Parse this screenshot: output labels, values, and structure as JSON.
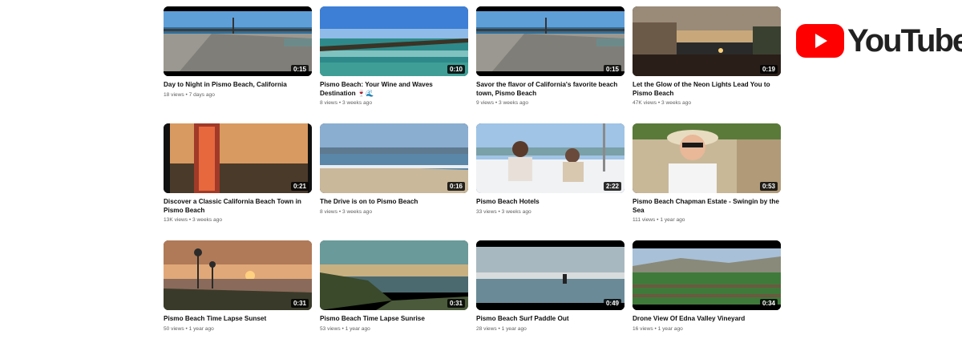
{
  "brand": {
    "name": "YouTube",
    "accent": "#ff0000"
  },
  "videos": [
    {
      "title": "Day to Night in Pismo Beach, California",
      "meta": "18 views • 7 days ago",
      "duration": "0:15",
      "thumb": "pier-pan"
    },
    {
      "title": "Pismo Beach: Your Wine and Waves Destination 🍷🌊",
      "meta": "8 views • 3 weeks ago",
      "duration": "0:10",
      "thumb": "pier-ocean"
    },
    {
      "title": "Savor the flavor of California's favorite beach town, Pismo Beach",
      "meta": "9 views • 3 weeks ago",
      "duration": "0:15",
      "thumb": "pier-pan"
    },
    {
      "title": "Let the Glow of the Neon Lights Lead You to Pismo Beach",
      "meta": "47K views • 3 weeks ago",
      "duration": "0:19",
      "thumb": "dusk-street"
    },
    {
      "title": "Discover a Classic California Beach Town in Pismo Beach",
      "meta": "13K views • 3 weeks ago",
      "duration": "0:21",
      "thumb": "pismo-sign"
    },
    {
      "title": "The Drive is on to Pismo Beach",
      "meta": "8 views • 3 weeks ago",
      "duration": "0:16",
      "thumb": "beach-shore"
    },
    {
      "title": "Pismo Beach Hotels",
      "meta": "33 views • 3 weeks ago",
      "duration": "2:22",
      "thumb": "terrace-dining"
    },
    {
      "title": "Pismo Beach Chapman Estate - Swingin by the Sea",
      "meta": "111 views • 1 year ago",
      "duration": "0:53",
      "thumb": "woman-hat"
    },
    {
      "title": "Pismo Beach Time Lapse Sunset",
      "meta": "50 views • 1 year ago",
      "duration": "0:31",
      "thumb": "sunset-palms"
    },
    {
      "title": "Pismo Beach Time Lapse Sunrise",
      "meta": "53 views • 1 year ago",
      "duration": "0:31",
      "thumb": "sunrise-coast"
    },
    {
      "title": "Pismo Beach Surf Paddle Out",
      "meta": "28 views • 1 year ago",
      "duration": "0:49",
      "thumb": "surf-paddle"
    },
    {
      "title": "Drone View Of Edna Valley Vineyard",
      "meta": "16 views • 1 year ago",
      "duration": "0:34",
      "thumb": "vineyard"
    }
  ]
}
